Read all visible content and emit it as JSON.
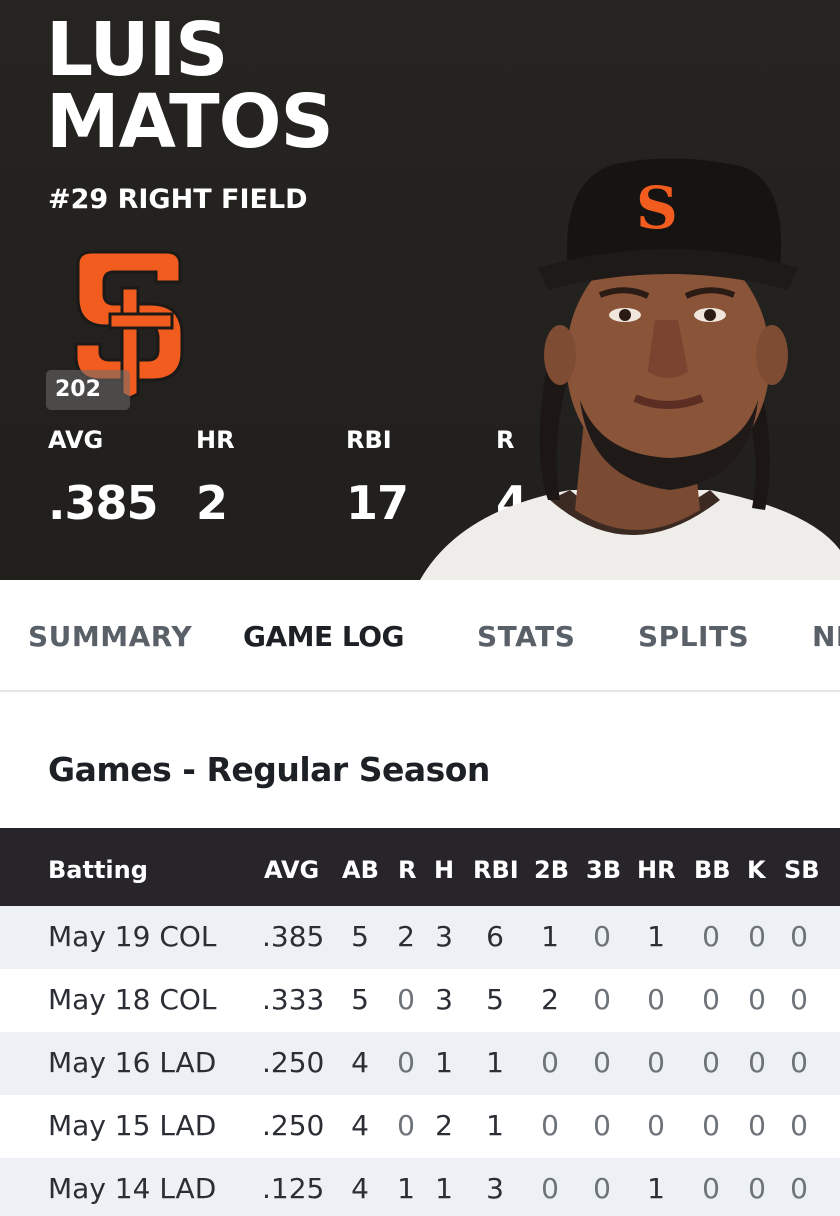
{
  "player": {
    "first_name": "LUIS",
    "last_name": "MATOS",
    "number_position": "#29 RIGHT FIELD",
    "year_badge": "202",
    "team_colors": {
      "orange": "#f25c1e",
      "black": "#262421"
    }
  },
  "summary_stats": [
    {
      "label": "AVG",
      "value": ".385"
    },
    {
      "label": "HR",
      "value": "2"
    },
    {
      "label": "RBI",
      "value": "17"
    },
    {
      "label": "R",
      "value": "4"
    }
  ],
  "tabs": [
    {
      "label": "SUMMARY",
      "active": false
    },
    {
      "label": "GAME LOG",
      "active": true
    },
    {
      "label": "STATS",
      "active": false
    },
    {
      "label": "SPLITS",
      "active": false
    },
    {
      "label": "NE",
      "active": false
    }
  ],
  "section_title": "Games - Regular Season",
  "table": {
    "headers": [
      "Batting",
      "AVG",
      "AB",
      "R",
      "H",
      "RBI",
      "2B",
      "3B",
      "HR",
      "BB",
      "K",
      "SB"
    ],
    "rows": [
      [
        "May 19 COL",
        ".385",
        "5",
        "2",
        "3",
        "6",
        "1",
        "0",
        "1",
        "0",
        "0",
        "0"
      ],
      [
        "May 18 COL",
        ".333",
        "5",
        "0",
        "3",
        "5",
        "2",
        "0",
        "0",
        "0",
        "0",
        "0"
      ],
      [
        "May 16 LAD",
        ".250",
        "4",
        "0",
        "1",
        "1",
        "0",
        "0",
        "0",
        "0",
        "0",
        "0"
      ],
      [
        "May 15 LAD",
        ".250",
        "4",
        "0",
        "2",
        "1",
        "0",
        "0",
        "0",
        "0",
        "0",
        "0"
      ],
      [
        "May 14 LAD",
        ".125",
        "4",
        "1",
        "1",
        "3",
        "0",
        "0",
        "1",
        "0",
        "0",
        "0"
      ]
    ]
  }
}
